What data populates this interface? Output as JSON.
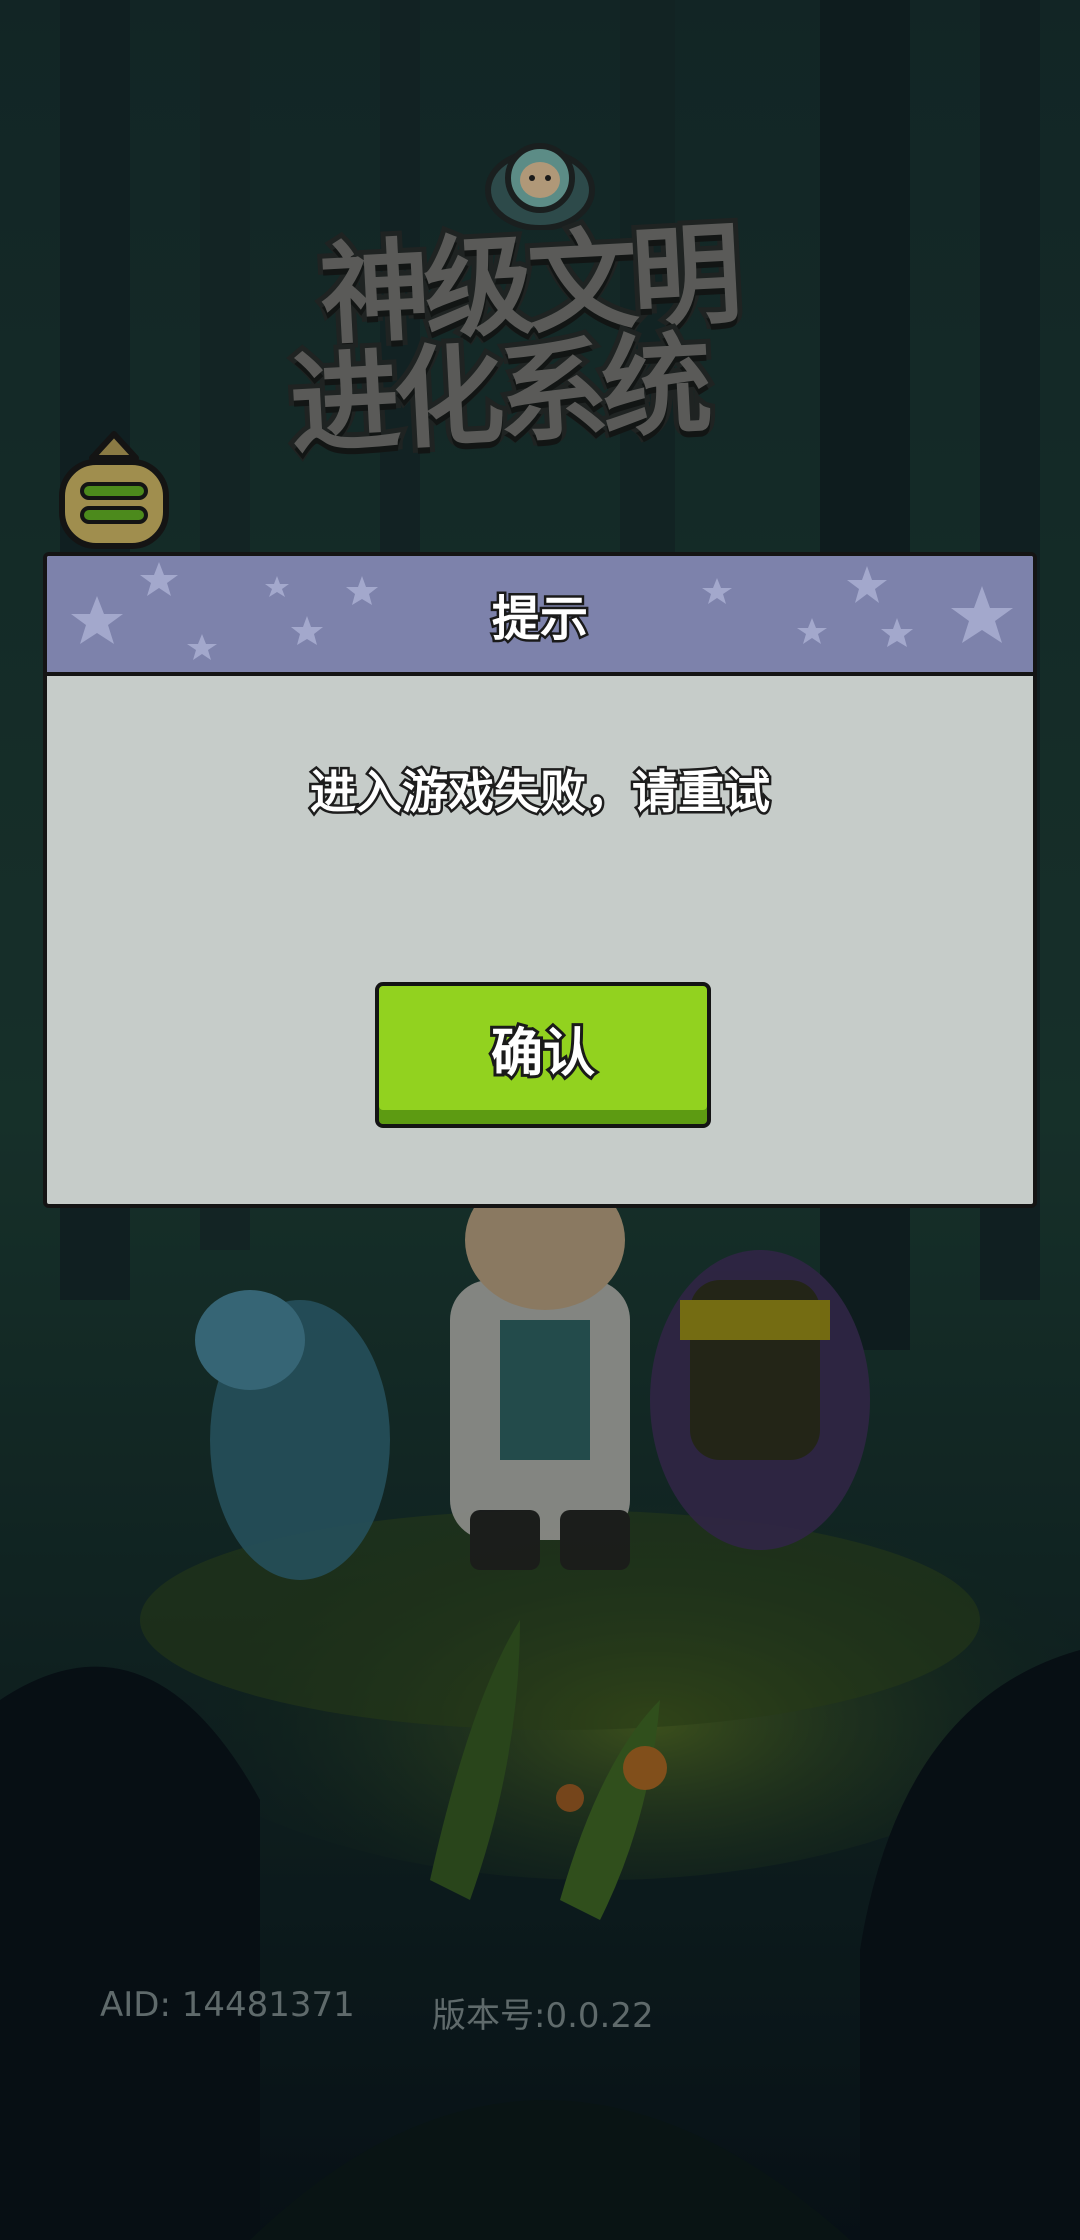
{
  "logo": {
    "line1": "神级文明",
    "line2": "进化系统"
  },
  "icons": {
    "menu": "menu-lines-icon",
    "mascot": "mascot-badge-icon"
  },
  "dialog": {
    "title": "提示",
    "message": "进入游戏失败，请重试",
    "confirm_label": "确认"
  },
  "footer": {
    "aid": "AID:  14481371",
    "version": "版本号:0.0.22"
  },
  "colors": {
    "header": "#7d82ab",
    "dialog_body": "#c6ccc9",
    "confirm_button": "#92d21f"
  }
}
